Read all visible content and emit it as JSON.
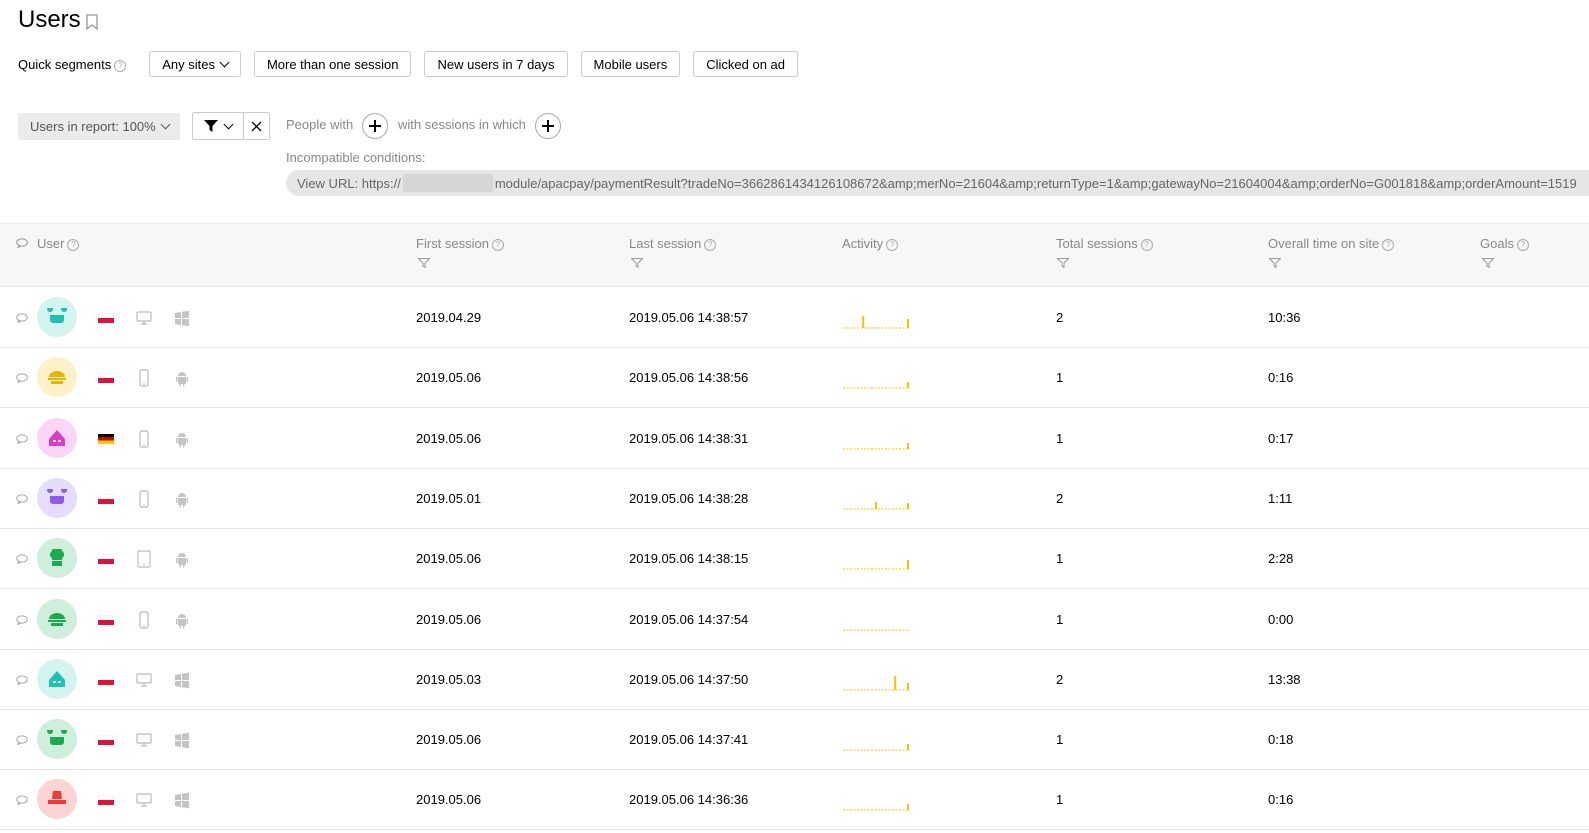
{
  "page": {
    "title": "Users"
  },
  "quick_segments": {
    "label": "Quick segments",
    "help": "?",
    "buttons": [
      "Any sites",
      "More than one session",
      "New users in 7 days",
      "Mobile users",
      "Clicked on ad"
    ]
  },
  "filters": {
    "users_in_report": "Users in report: 100%",
    "people_with": "People with",
    "with_sessions": "with sessions in which",
    "incompatible": "Incompatible conditions:",
    "view_url_prefix": "View URL: https://",
    "view_url_rest": "module/apacpay/paymentResult?tradeNo=3662861434126108672&amp;merNo=21604&amp;returnType=1&amp;gatewayNo=21604004&amp;orderNo=G001818&amp;orderAmount=1519"
  },
  "columns": {
    "user": "User",
    "first_session": "First session",
    "last_session": "Last session",
    "activity": "Activity",
    "total_sessions": "Total sessions",
    "overall_time": "Overall time on site",
    "goals": "Goals"
  },
  "colors": {
    "activity_bar": "#f5c400",
    "avatar_teal": "#d4f4ef",
    "avatar_teal_fg": "#1fc1b0",
    "avatar_yellow": "#fdf1c8",
    "avatar_yellow_fg": "#e8b400",
    "avatar_pink": "#fbd6f4",
    "avatar_pink_fg": "#d63ec3",
    "avatar_purple": "#e6dcfb",
    "avatar_purple_fg": "#8a5cf0",
    "avatar_green": "#cfeedb",
    "avatar_green_fg": "#1caa4e",
    "avatar_red": "#fdd4d4",
    "avatar_red_fg": "#ec3b3b"
  },
  "rows": [
    {
      "avatar": "teal",
      "avatar_icon": "bear-icon",
      "flag": "poland",
      "device": "desktop",
      "os": "windows",
      "first": "2019.04.29",
      "last": "2019.05.06 14:38:57",
      "activity": [
        0,
        0,
        0,
        0.6,
        0,
        0,
        0,
        0,
        0,
        0,
        0.45
      ],
      "sessions": "2",
      "time": "10:36"
    },
    {
      "avatar": "yellow",
      "avatar_icon": "cap-icon",
      "flag": "poland",
      "device": "mobile",
      "os": "android",
      "first": "2019.05.06",
      "last": "2019.05.06 14:38:56",
      "activity": [
        0,
        0,
        0,
        0,
        0,
        0,
        0,
        0,
        0,
        0,
        0.3
      ],
      "sessions": "1",
      "time": "0:16"
    },
    {
      "avatar": "pink",
      "avatar_icon": "hood-icon",
      "flag": "germany",
      "device": "mobile",
      "os": "android",
      "first": "2019.05.06",
      "last": "2019.05.06 14:38:31",
      "activity": [
        0,
        0,
        0,
        0,
        0,
        0,
        0,
        0,
        0,
        0,
        0.3
      ],
      "sessions": "1",
      "time": "0:17"
    },
    {
      "avatar": "purple",
      "avatar_icon": "bear-icon",
      "flag": "poland",
      "device": "mobile",
      "os": "android",
      "first": "2019.05.01",
      "last": "2019.05.06 14:38:28",
      "activity": [
        0,
        0,
        0,
        0,
        0,
        0.35,
        0,
        0,
        0,
        0,
        0.3
      ],
      "sessions": "2",
      "time": "1:11"
    },
    {
      "avatar": "green",
      "avatar_icon": "chef-icon",
      "flag": "poland",
      "device": "tablet",
      "os": "android",
      "first": "2019.05.06",
      "last": "2019.05.06 14:38:15",
      "activity": [
        0,
        0,
        0,
        0,
        0,
        0,
        0,
        0,
        0,
        0,
        0.45
      ],
      "sessions": "1",
      "time": "2:28"
    },
    {
      "avatar": "green",
      "avatar_icon": "cap-icon",
      "flag": "poland",
      "device": "mobile",
      "os": "android",
      "first": "2019.05.06",
      "last": "2019.05.06 14:37:54",
      "activity": [
        0,
        0,
        0,
        0,
        0,
        0,
        0,
        0,
        0,
        0,
        0
      ],
      "sessions": "1",
      "time": "0:00"
    },
    {
      "avatar": "teal",
      "avatar_icon": "hood-icon",
      "flag": "poland",
      "device": "desktop",
      "os": "windows",
      "first": "2019.05.03",
      "last": "2019.05.06 14:37:50",
      "activity": [
        0,
        0,
        0,
        0,
        0,
        0,
        0,
        0,
        0.7,
        0,
        0.35
      ],
      "sessions": "2",
      "time": "13:38"
    },
    {
      "avatar": "green",
      "avatar_icon": "bear-icon",
      "flag": "poland",
      "device": "desktop",
      "os": "windows",
      "first": "2019.05.06",
      "last": "2019.05.06 14:37:41",
      "activity": [
        0,
        0,
        0,
        0,
        0,
        0,
        0,
        0,
        0,
        0,
        0.3
      ],
      "sessions": "1",
      "time": "0:18"
    },
    {
      "avatar": "red",
      "avatar_icon": "hat-icon",
      "flag": "poland",
      "device": "desktop",
      "os": "windows",
      "first": "2019.05.06",
      "last": "2019.05.06 14:36:36",
      "activity": [
        0,
        0,
        0,
        0,
        0,
        0,
        0,
        0,
        0,
        0,
        0.3
      ],
      "sessions": "1",
      "time": "0:16"
    }
  ]
}
